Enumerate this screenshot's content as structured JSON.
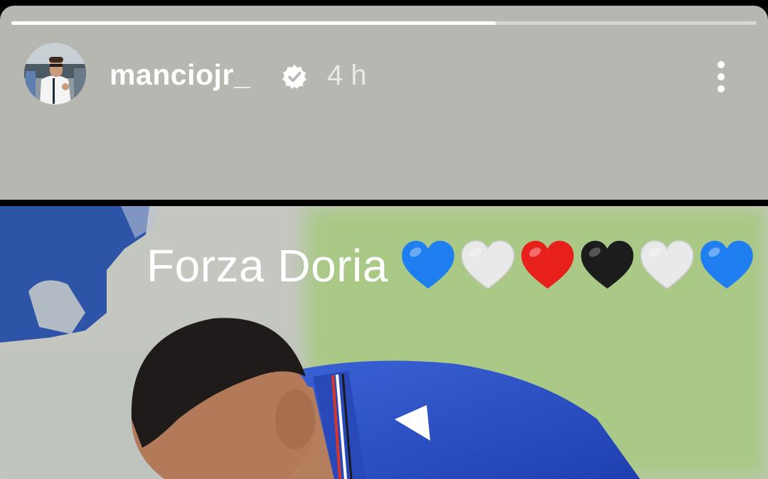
{
  "story": {
    "progress": 0.65,
    "username": "manciojr_",
    "timestamp": "4 h",
    "verified": true,
    "caption": "Forza Doria",
    "hearts": [
      "blue",
      "white",
      "red",
      "black",
      "white",
      "blue"
    ]
  },
  "colors": {
    "header_background": "#b6b7b1",
    "sampdoria_blue": "#2e5db7",
    "heart_blue": "#1f7ff0",
    "heart_white": "#e9e9e9",
    "heart_red": "#e8201c",
    "heart_black": "#1c1c1c"
  },
  "icons": {
    "verified": "verified-badge-icon",
    "more": "more-vertical-icon"
  }
}
